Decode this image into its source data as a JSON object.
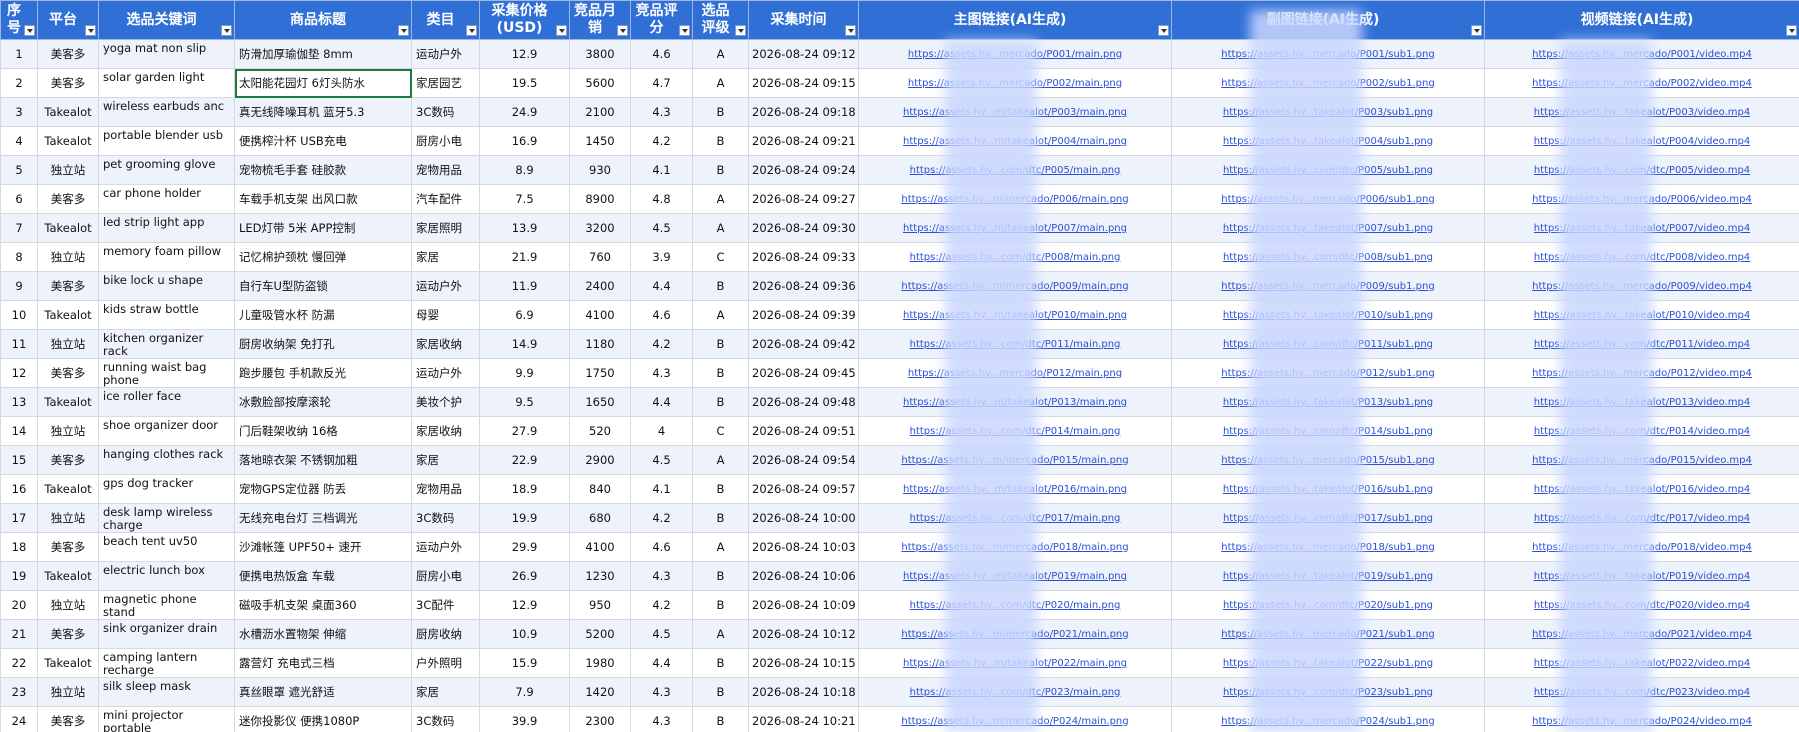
{
  "columns": [
    {
      "label": "序号"
    },
    {
      "label": "平台"
    },
    {
      "label": "选品关键词"
    },
    {
      "label": "商品标题"
    },
    {
      "label": "类目"
    },
    {
      "label": "采集价格(USD)"
    },
    {
      "label": "竞品月销"
    },
    {
      "label": "竞品评分"
    },
    {
      "label": "选品评级"
    },
    {
      "label": "采集时间"
    },
    {
      "label": "主图链接(AI生成)"
    },
    {
      "label": "副图链接(AI生成)"
    },
    {
      "label": "视频链接(AI生成)"
    }
  ],
  "rows": [
    [
      "1",
      "美客多",
      "yoga mat non slip",
      "防滑加厚瑜伽垫 8mm",
      "运动户外",
      "12.9",
      "3800",
      "4.6",
      "A",
      "2026-08-24 09:12",
      "https://assets.hy...mercado/P001/main.png",
      "https://assets.hy...mercado/P001/sub1.png",
      "https://assets.hy...mercado/P001/video.mp4"
    ],
    [
      "2",
      "美客多",
      "solar garden light",
      "太阳能花园灯 6灯头防水",
      "家居园艺",
      "19.5",
      "5600",
      "4.7",
      "A",
      "2026-08-24 09:15",
      "https://assets.hy...mercado/P002/main.png",
      "https://assets.hy...mercado/P002/sub1.png",
      "https://assets.hy...mercado/P002/video.mp4"
    ],
    [
      "3",
      "Takealot",
      "wireless earbuds anc",
      "真无线降噪耳机 蓝牙5.3",
      "3C数码",
      "24.9",
      "2100",
      "4.3",
      "B",
      "2026-08-24 09:18",
      "https://assets.hy...m/takealot/P003/main.png",
      "https://assets.hy...takealot/P003/sub1.png",
      "https://assets.hy...takealot/P003/video.mp4"
    ],
    [
      "4",
      "Takealot",
      "portable blender usb",
      "便携榨汁杯 USB充电",
      "厨房小电",
      "16.9",
      "1450",
      "4.2",
      "B",
      "2026-08-24 09:21",
      "https://assets.hy...m/takealot/P004/main.png",
      "https://assets.hy...takealot/P004/sub1.png",
      "https://assets.hy...takealot/P004/video.mp4"
    ],
    [
      "5",
      "独立站",
      "pet grooming glove",
      "宠物梳毛手套 硅胶款",
      "宠物用品",
      "8.9",
      "930",
      "4.1",
      "B",
      "2026-08-24 09:24",
      "https://assets.hy...com/dtc/P005/main.png",
      "https://assets.hy...com/dtc/P005/sub1.png",
      "https://assets.hy...com/dtc/P005/video.mp4"
    ],
    [
      "6",
      "美客多",
      "car phone holder",
      "车载手机支架 出风口款",
      "汽车配件",
      "7.5",
      "8900",
      "4.8",
      "A",
      "2026-08-24 09:27",
      "https://assets.hy...m/mercado/P006/main.png",
      "https://assets.hy...mercado/P006/sub1.png",
      "https://assets.hy...mercado/P006/video.mp4"
    ],
    [
      "7",
      "Takealot",
      "led strip light app",
      "LED灯带 5米 APP控制",
      "家居照明",
      "13.9",
      "3200",
      "4.5",
      "A",
      "2026-08-24 09:30",
      "https://assets.hy...m/takealot/P007/main.png",
      "https://assets.hy...takealot/P007/sub1.png",
      "https://assets.hy...takealot/P007/video.mp4"
    ],
    [
      "8",
      "独立站",
      "memory foam pillow",
      "记忆棉护颈枕 慢回弹",
      "家居",
      "21.9",
      "760",
      "3.9",
      "C",
      "2026-08-24 09:33",
      "https://assets.hy...com/dtc/P008/main.png",
      "https://assets.hy...com/dtc/P008/sub1.png",
      "https://assets.hy...com/dtc/P008/video.mp4"
    ],
    [
      "9",
      "美客多",
      "bike lock u shape",
      "自行车U型防盗锁",
      "运动户外",
      "11.9",
      "2400",
      "4.4",
      "B",
      "2026-08-24 09:36",
      "https://assets.hy...m/mercado/P009/main.png",
      "https://assets.hy...mercado/P009/sub1.png",
      "https://assets.hy...mercado/P009/video.mp4"
    ],
    [
      "10",
      "Takealot",
      "kids straw bottle",
      "儿童吸管水杯 防漏",
      "母婴",
      "6.9",
      "4100",
      "4.6",
      "A",
      "2026-08-24 09:39",
      "https://assets.hy...m/takealot/P010/main.png",
      "https://assets.hy...takealot/P010/sub1.png",
      "https://assets.hy...takealot/P010/video.mp4"
    ],
    [
      "11",
      "独立站",
      "kitchen organizer rack",
      "厨房收纳架 免打孔",
      "家居收纳",
      "14.9",
      "1180",
      "4.2",
      "B",
      "2026-08-24 09:42",
      "https://assets.hy...com/dtc/P011/main.png",
      "https://assets.hy...com/dtc/P011/sub1.png",
      "https://assets.hy...com/dtc/P011/video.mp4"
    ],
    [
      "12",
      "美客多",
      "running waist bag phone",
      "跑步腰包 手机款反光",
      "运动户外",
      "9.9",
      "1750",
      "4.3",
      "B",
      "2026-08-24 09:45",
      "https://assets.hy...mercado/P012/main.png",
      "https://assets.hy...mercado/P012/sub1.png",
      "https://assets.hy...mercado/P012/video.mp4"
    ],
    [
      "13",
      "Takealot",
      "ice roller face",
      "冰敷脸部按摩滚轮",
      "美妆个护",
      "9.5",
      "1650",
      "4.4",
      "B",
      "2026-08-24 09:48",
      "https://assets.hy...m/takealot/P013/main.png",
      "https://assets.hy...takealot/P013/sub1.png",
      "https://assets.hy...takealot/P013/video.mp4"
    ],
    [
      "14",
      "独立站",
      "shoe organizer door",
      "门后鞋架收纳 16格",
      "家居收纳",
      "27.9",
      "520",
      "4",
      "C",
      "2026-08-24 09:51",
      "https://assets.hy...com/dtc/P014/main.png",
      "https://assets.hy...com/dtc/P014/sub1.png",
      "https://assets.hy...com/dtc/P014/video.mp4"
    ],
    [
      "15",
      "美客多",
      "hanging clothes rack",
      "落地晾衣架 不锈钢加粗",
      "家居",
      "22.9",
      "2900",
      "4.5",
      "A",
      "2026-08-24 09:54",
      "https://assets.hy...m/mercado/P015/main.png",
      "https://assets.hy...mercado/P015/sub1.png",
      "https://assets.hy...mercado/P015/video.mp4"
    ],
    [
      "16",
      "Takealot",
      "gps dog tracker",
      "宠物GPS定位器 防丢",
      "宠物用品",
      "18.9",
      "840",
      "4.1",
      "B",
      "2026-08-24 09:57",
      "https://assets.hy...m/takealot/P016/main.png",
      "https://assets.hy...takealot/P016/sub1.png",
      "https://assets.hy...takealot/P016/video.mp4"
    ],
    [
      "17",
      "独立站",
      "desk lamp wireless charge",
      "无线充电台灯 三档调光",
      "3C数码",
      "19.9",
      "680",
      "4.2",
      "B",
      "2026-08-24 10:00",
      "https://assets.hy...com/dtc/P017/main.png",
      "https://assets.hy...com/dtc/P017/sub1.png",
      "https://assets.hy...com/dtc/P017/video.mp4"
    ],
    [
      "18",
      "美客多",
      "beach tent uv50",
      "沙滩帐篷 UPF50+ 速开",
      "运动户外",
      "29.9",
      "4100",
      "4.6",
      "A",
      "2026-08-24 10:03",
      "https://assets.hy...m/mercado/P018/main.png",
      "https://assets.hy...mercado/P018/sub1.png",
      "https://assets.hy...mercado/P018/video.mp4"
    ],
    [
      "19",
      "Takealot",
      "electric lunch box",
      "便携电热饭盒 车载",
      "厨房小电",
      "26.9",
      "1230",
      "4.3",
      "B",
      "2026-08-24 10:06",
      "https://assets.hy...m/takealot/P019/main.png",
      "https://assets.hy...takealot/P019/sub1.png",
      "https://assets.hy...takealot/P019/video.mp4"
    ],
    [
      "20",
      "独立站",
      "magnetic phone stand",
      "磁吸手机支架 桌面360",
      "3C配件",
      "12.9",
      "950",
      "4.2",
      "B",
      "2026-08-24 10:09",
      "https://assets.hy...com/dtc/P020/main.png",
      "https://assets.hy...com/dtc/P020/sub1.png",
      "https://assets.hy...com/dtc/P020/video.mp4"
    ],
    [
      "21",
      "美客多",
      "sink organizer drain",
      "水槽沥水置物架 伸缩",
      "厨房收纳",
      "10.9",
      "5200",
      "4.5",
      "A",
      "2026-08-24 10:12",
      "https://assets.hy...m/mercado/P021/main.png",
      "https://assets.hy...mercado/P021/sub1.png",
      "https://assets.hy...mercado/P021/video.mp4"
    ],
    [
      "22",
      "Takealot",
      "camping lantern recharge",
      "露营灯 充电式三档",
      "户外照明",
      "15.9",
      "1980",
      "4.4",
      "B",
      "2026-08-24 10:15",
      "https://assets.hy...m/takealot/P022/main.png",
      "https://assets.hy...takealot/P022/sub1.png",
      "https://assets.hy...takealot/P022/video.mp4"
    ],
    [
      "23",
      "独立站",
      "silk sleep mask",
      "真丝眼罩 遮光舒适",
      "家居",
      "7.9",
      "1420",
      "4.3",
      "B",
      "2026-08-24 10:18",
      "https://assets.hy...com/dtc/P023/main.png",
      "https://assets.hy...com/dtc/P023/sub1.png",
      "https://assets.hy...com/dtc/P023/video.mp4"
    ],
    [
      "24",
      "美客多",
      "mini projector portable",
      "迷你投影仪 便携1080P",
      "3C数码",
      "39.9",
      "2300",
      "4.3",
      "B",
      "2026-08-24 10:21",
      "https://assets.hy...m/mercado/P024/main.png",
      "https://assets.hy...mercado/P024/sub1.png",
      "https://assets.hy...mercado/P024/video.mp4"
    ]
  ],
  "active_cell": {
    "row": 2,
    "column": "商品标题"
  },
  "colors": {
    "header_bg": "#2f6fd6",
    "header_text": "#ffffff",
    "row_alt": "#eef3fb",
    "link": "#2a4fd4",
    "active_border": "#1e7a3a"
  }
}
